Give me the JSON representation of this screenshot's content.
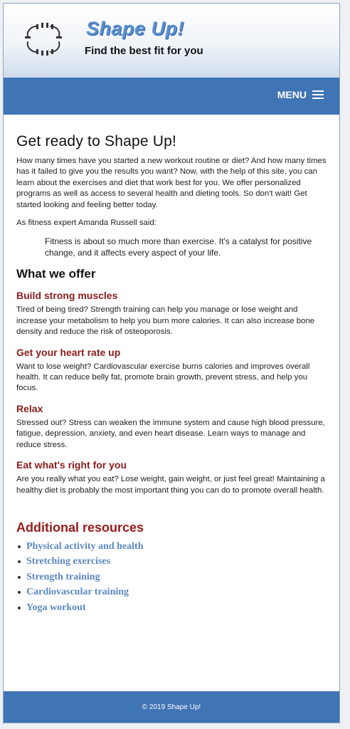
{
  "header": {
    "brand": "Shape Up!",
    "tagline": "Find the best fit for you",
    "logo_icon": "dumbbell-ring-icon"
  },
  "nav": {
    "menu_label": "MENU",
    "menu_icon": "hamburger-icon"
  },
  "main": {
    "title": "Get ready to Shape Up!",
    "intro": "How many times have you started a new workout routine or diet? And how many times has it failed to give you the results you want? Now, with the help of this site, you can learn about the exercises and diet that work best for you. We offer personalized programs as well as access to several health and dieting tools. So don't wait! Get started looking and feeling better today.",
    "quote_intro": "As fitness expert Amanda Russell said:",
    "quote": "Fitness is about so much more than exercise. It's a catalyst for positive change, and it affects every aspect of your life.",
    "offer_title": "What we offer",
    "sections": [
      {
        "title": "Build strong muscles",
        "body": "Tired of being tired? Strength training can help you manage or lose weight and increase your metabolism to help you burn more calories. It can also increase bone density and reduce the risk of osteoporosis."
      },
      {
        "title": "Get your heart rate up",
        "body": "Want to lose weight? Cardiovascular exercise burns calories and improves overall health. It can reduce belly fat, promote brain growth, prevent stress, and help you focus."
      },
      {
        "title": "Relax",
        "body": "Stressed out? Stress can weaken the immune system and cause high blood pressure, fatigue, depression, anxiety, and even heart disease. Learn ways to manage and reduce stress."
      },
      {
        "title": "Eat what's right for you",
        "body": "Are you really what you eat? Lose weight, gain weight, or just feel great! Maintaining a healthy diet is probably the most important thing you can do to promote overall health."
      }
    ],
    "resources_title": "Additional resources",
    "resources": [
      "Physical activity and health",
      "Stretching exercises",
      "Strength training",
      "Cardiovascular training",
      "Yoga workout"
    ]
  },
  "footer": {
    "copyright": "© 2019 Shape Up!"
  },
  "colors": {
    "nav_blue": "#3f74b5",
    "heading_red": "#8b1c1c",
    "link_blue": "#5a88c2"
  }
}
